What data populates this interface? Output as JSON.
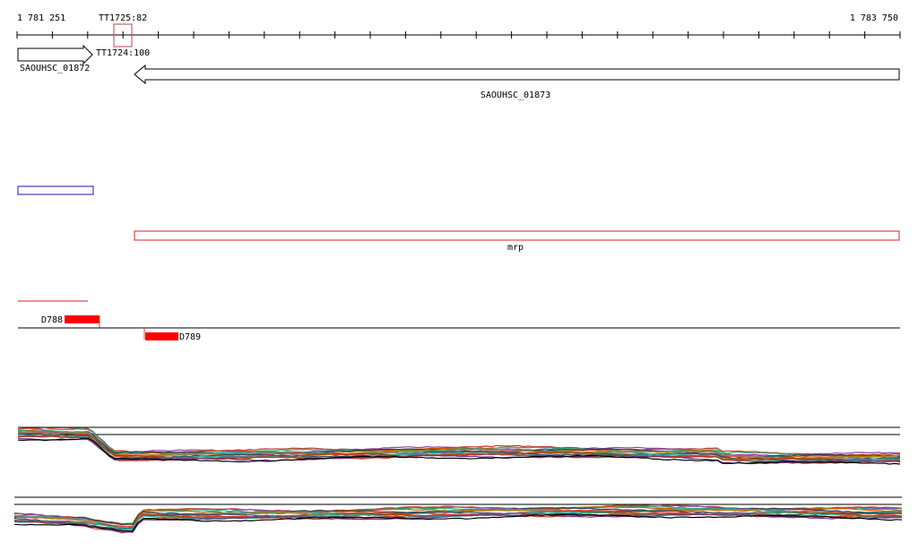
{
  "ruler": {
    "start_label": "1 781 251",
    "end_label": "1 783 750",
    "marker_label": "TT1725:82"
  },
  "annotations": {
    "marker2_label": "TT1724:100"
  },
  "genes": [
    {
      "name": "SAOUHSC_01872",
      "strand": "+"
    },
    {
      "name": "SAOUHSC_01873",
      "strand": "-"
    }
  ],
  "features": {
    "mrp_label": "mrp"
  },
  "probes": {
    "d788_label": "D788",
    "d789_label": "D789"
  },
  "colors": {
    "gene_outline": "#000000",
    "blue_box": "#1a1aa0",
    "red_box": "#dd2222",
    "probe_fill": "#ff0000",
    "marker_box": "#b44444"
  }
}
